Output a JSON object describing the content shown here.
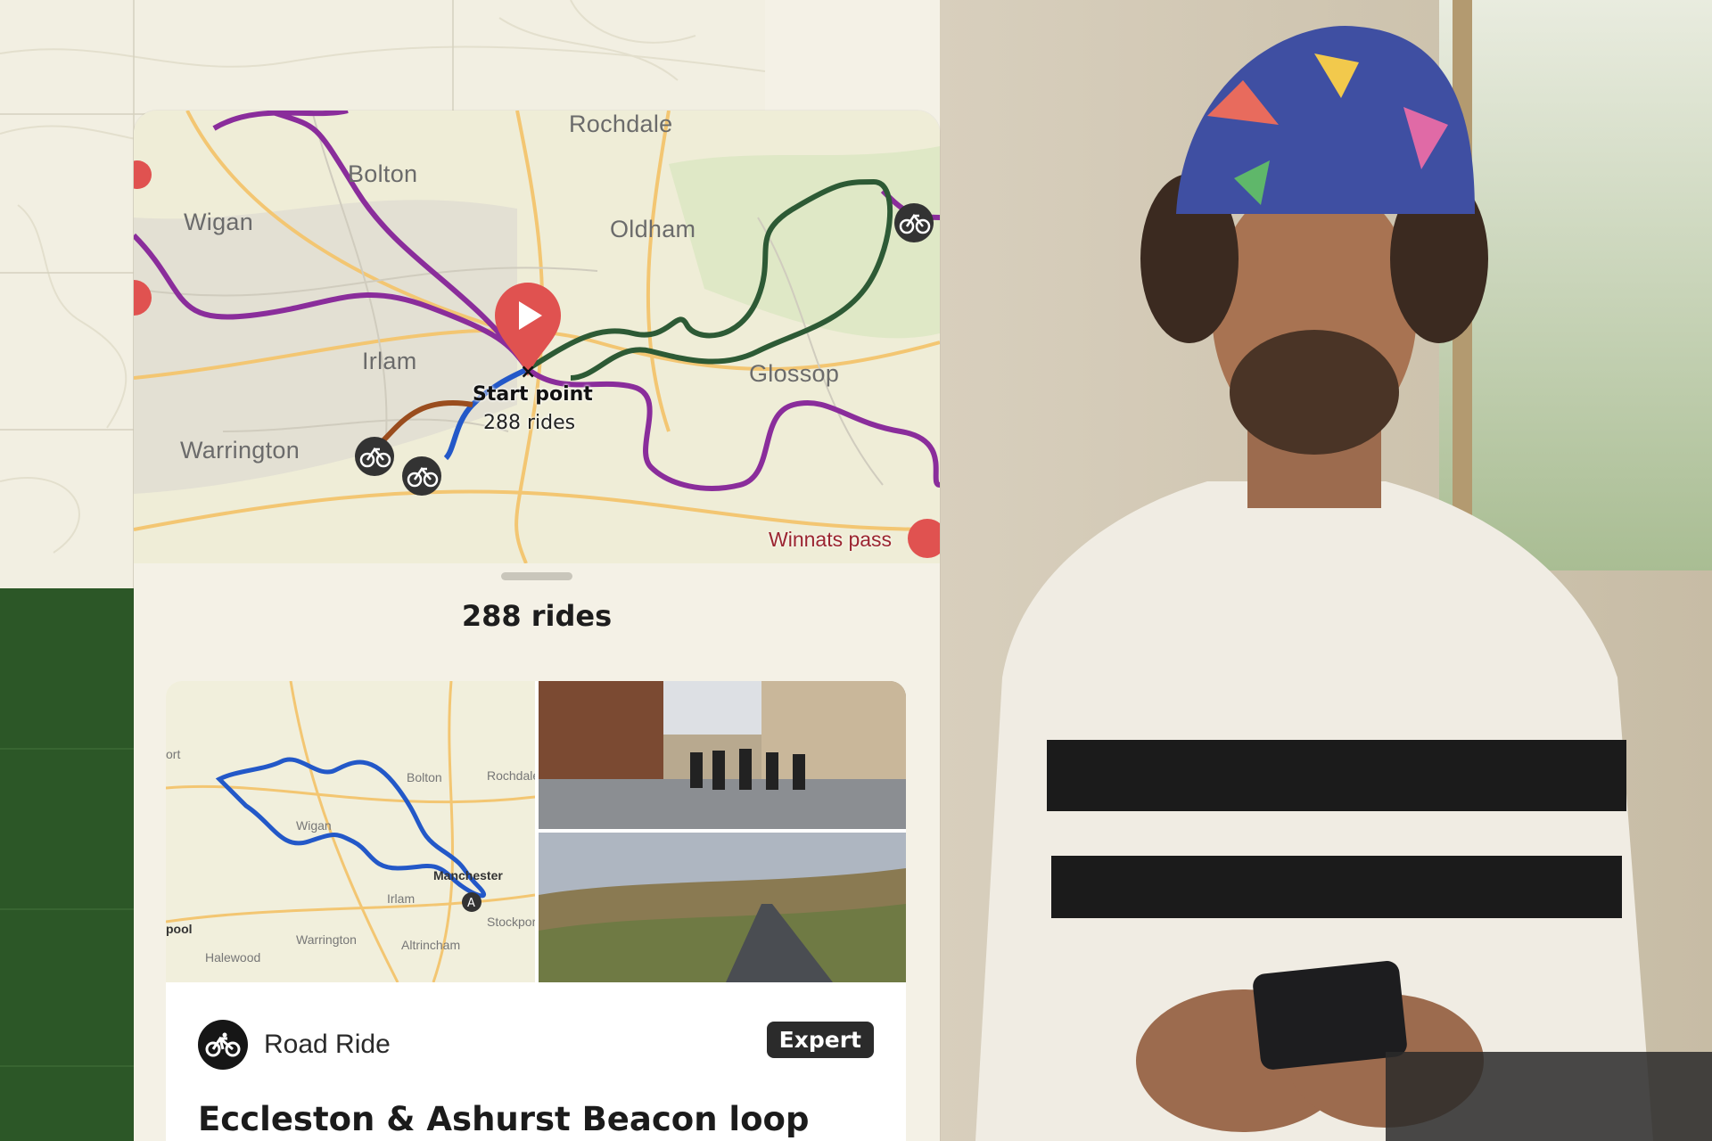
{
  "map": {
    "places": [
      "Rochdale",
      "Bolton",
      "Wigan",
      "Oldham",
      "Irlam",
      "Warrington",
      "Glossop"
    ],
    "start_point_label": "Start point",
    "start_point_rides": "288 rides",
    "poi_label": "Winnats pass",
    "route_colors": {
      "purple": "#8a2d9b",
      "green": "#2d5a35",
      "blue": "#2358c8",
      "brown": "#9a4d1e",
      "marker": "#e05250"
    }
  },
  "sheet": {
    "rides_count": "288 rides"
  },
  "card": {
    "map_labels": [
      "Rochdale",
      "Bolton",
      "Wigan",
      "Manchester",
      "Irlam",
      "Warrington",
      "Altrincham",
      "Halewood",
      "Stockport",
      "pool",
      "ort"
    ],
    "activity_icon": "bicycle-icon",
    "activity_label": "Road Ride",
    "difficulty": "Expert",
    "title": "Eccleston & Ashurst Beacon loop"
  }
}
